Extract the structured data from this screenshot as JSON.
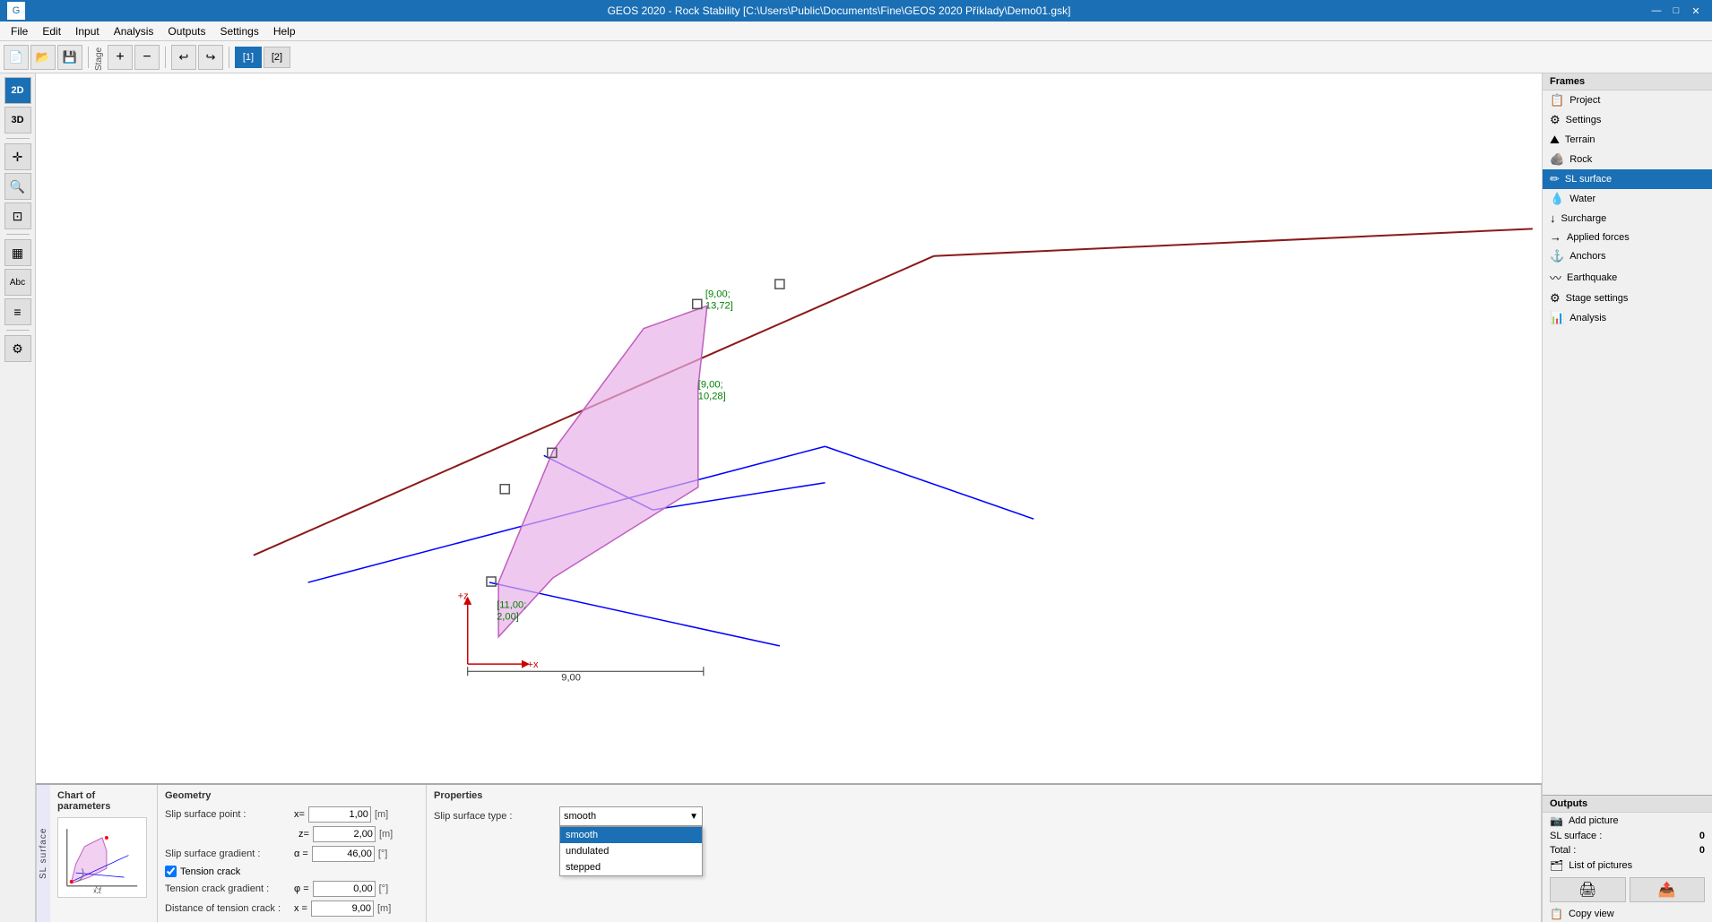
{
  "titlebar": {
    "title": "GEOS 2020 - Rock Stability [C:\\Users\\Public\\Documents\\Fine\\GEOS 2020 Příklady\\Demo01.gsk]",
    "minimize": "—",
    "maximize": "□",
    "close": "✕"
  },
  "menubar": {
    "items": [
      "File",
      "Edit",
      "Input",
      "Analysis",
      "Outputs",
      "Settings",
      "Help"
    ]
  },
  "toolbar": {
    "new": "📄",
    "open": "📂",
    "save": "💾",
    "undo": "↩",
    "redo": "↪",
    "stage_label": "Stage",
    "stage1": "[1]",
    "stage2": "[2]",
    "add_stage": "+",
    "remove_stage": "−"
  },
  "left_toolbar": {
    "btn_2d": "2D",
    "btn_3d": "3D",
    "btn_move": "✛",
    "btn_zoom": "🔍",
    "btn_select": "⊡",
    "btn_table": "▦",
    "btn_abc": "Abc",
    "btn_layers": "≡",
    "btn_settings": "⚙"
  },
  "frames": {
    "header": "Frames",
    "items": [
      {
        "label": "Project",
        "icon": "📋",
        "active": false
      },
      {
        "label": "Settings",
        "icon": "⚙",
        "active": false
      },
      {
        "label": "Terrain",
        "icon": "⛰",
        "active": false
      },
      {
        "label": "Rock",
        "icon": "🪨",
        "active": false
      },
      {
        "label": "SL surface",
        "icon": "✏",
        "active": true
      },
      {
        "label": "Water",
        "icon": "💧",
        "active": false
      },
      {
        "label": "Surcharge",
        "icon": "↓",
        "active": false
      },
      {
        "label": "Applied forces",
        "icon": "→",
        "active": false
      },
      {
        "label": "Anchors",
        "icon": "⚓",
        "active": false
      },
      {
        "label": "Earthquake",
        "icon": "〰",
        "active": false
      },
      {
        "label": "Stage settings",
        "icon": "⚙",
        "active": false
      },
      {
        "label": "Analysis",
        "icon": "📊",
        "active": false
      }
    ]
  },
  "outputs": {
    "header": "Outputs",
    "add_picture": "Add picture",
    "sl_surface_label": "SL surface :",
    "sl_surface_value": "0",
    "total_label": "Total :",
    "total_value": "0",
    "list_of_pictures": "List of pictures"
  },
  "canvas": {
    "coord_labels": [
      "9,00;↑13,72↑",
      "9,00;↑10,28↑",
      "11,00;↑2,00↑"
    ],
    "x_axis": "+x",
    "z_axis": "+z",
    "dim_9": "9,00"
  },
  "bottom": {
    "chart_title": "Chart of parameters",
    "geometry_title": "Geometry",
    "slip_surface_point_label": "Slip surface point :",
    "x_label": "x=",
    "x_value": "1,00",
    "x_unit": "[m]",
    "z_value": "2,00",
    "z_unit": "[m]",
    "slip_gradient_label": "Slip surface gradient :",
    "alpha_label": "α =",
    "alpha_value": "46,00",
    "alpha_unit": "[°]",
    "tension_crack_label": "Tension crack",
    "tension_crack_gradient_label": "Tension crack gradient :",
    "phi_label": "φ =",
    "phi_value": "0,00",
    "phi_unit": "[°]",
    "distance_label": "Distance of tension crack :",
    "dist_x_label": "x =",
    "dist_value": "9,00",
    "dist_unit": "[m]",
    "properties_title": "Properties",
    "slip_surface_type_label": "Slip surface type :",
    "type_value": "smooth",
    "type_options": [
      "smooth",
      "undulated",
      "stepped"
    ],
    "dropdown_open": true
  },
  "vertical_label": "SL surface"
}
